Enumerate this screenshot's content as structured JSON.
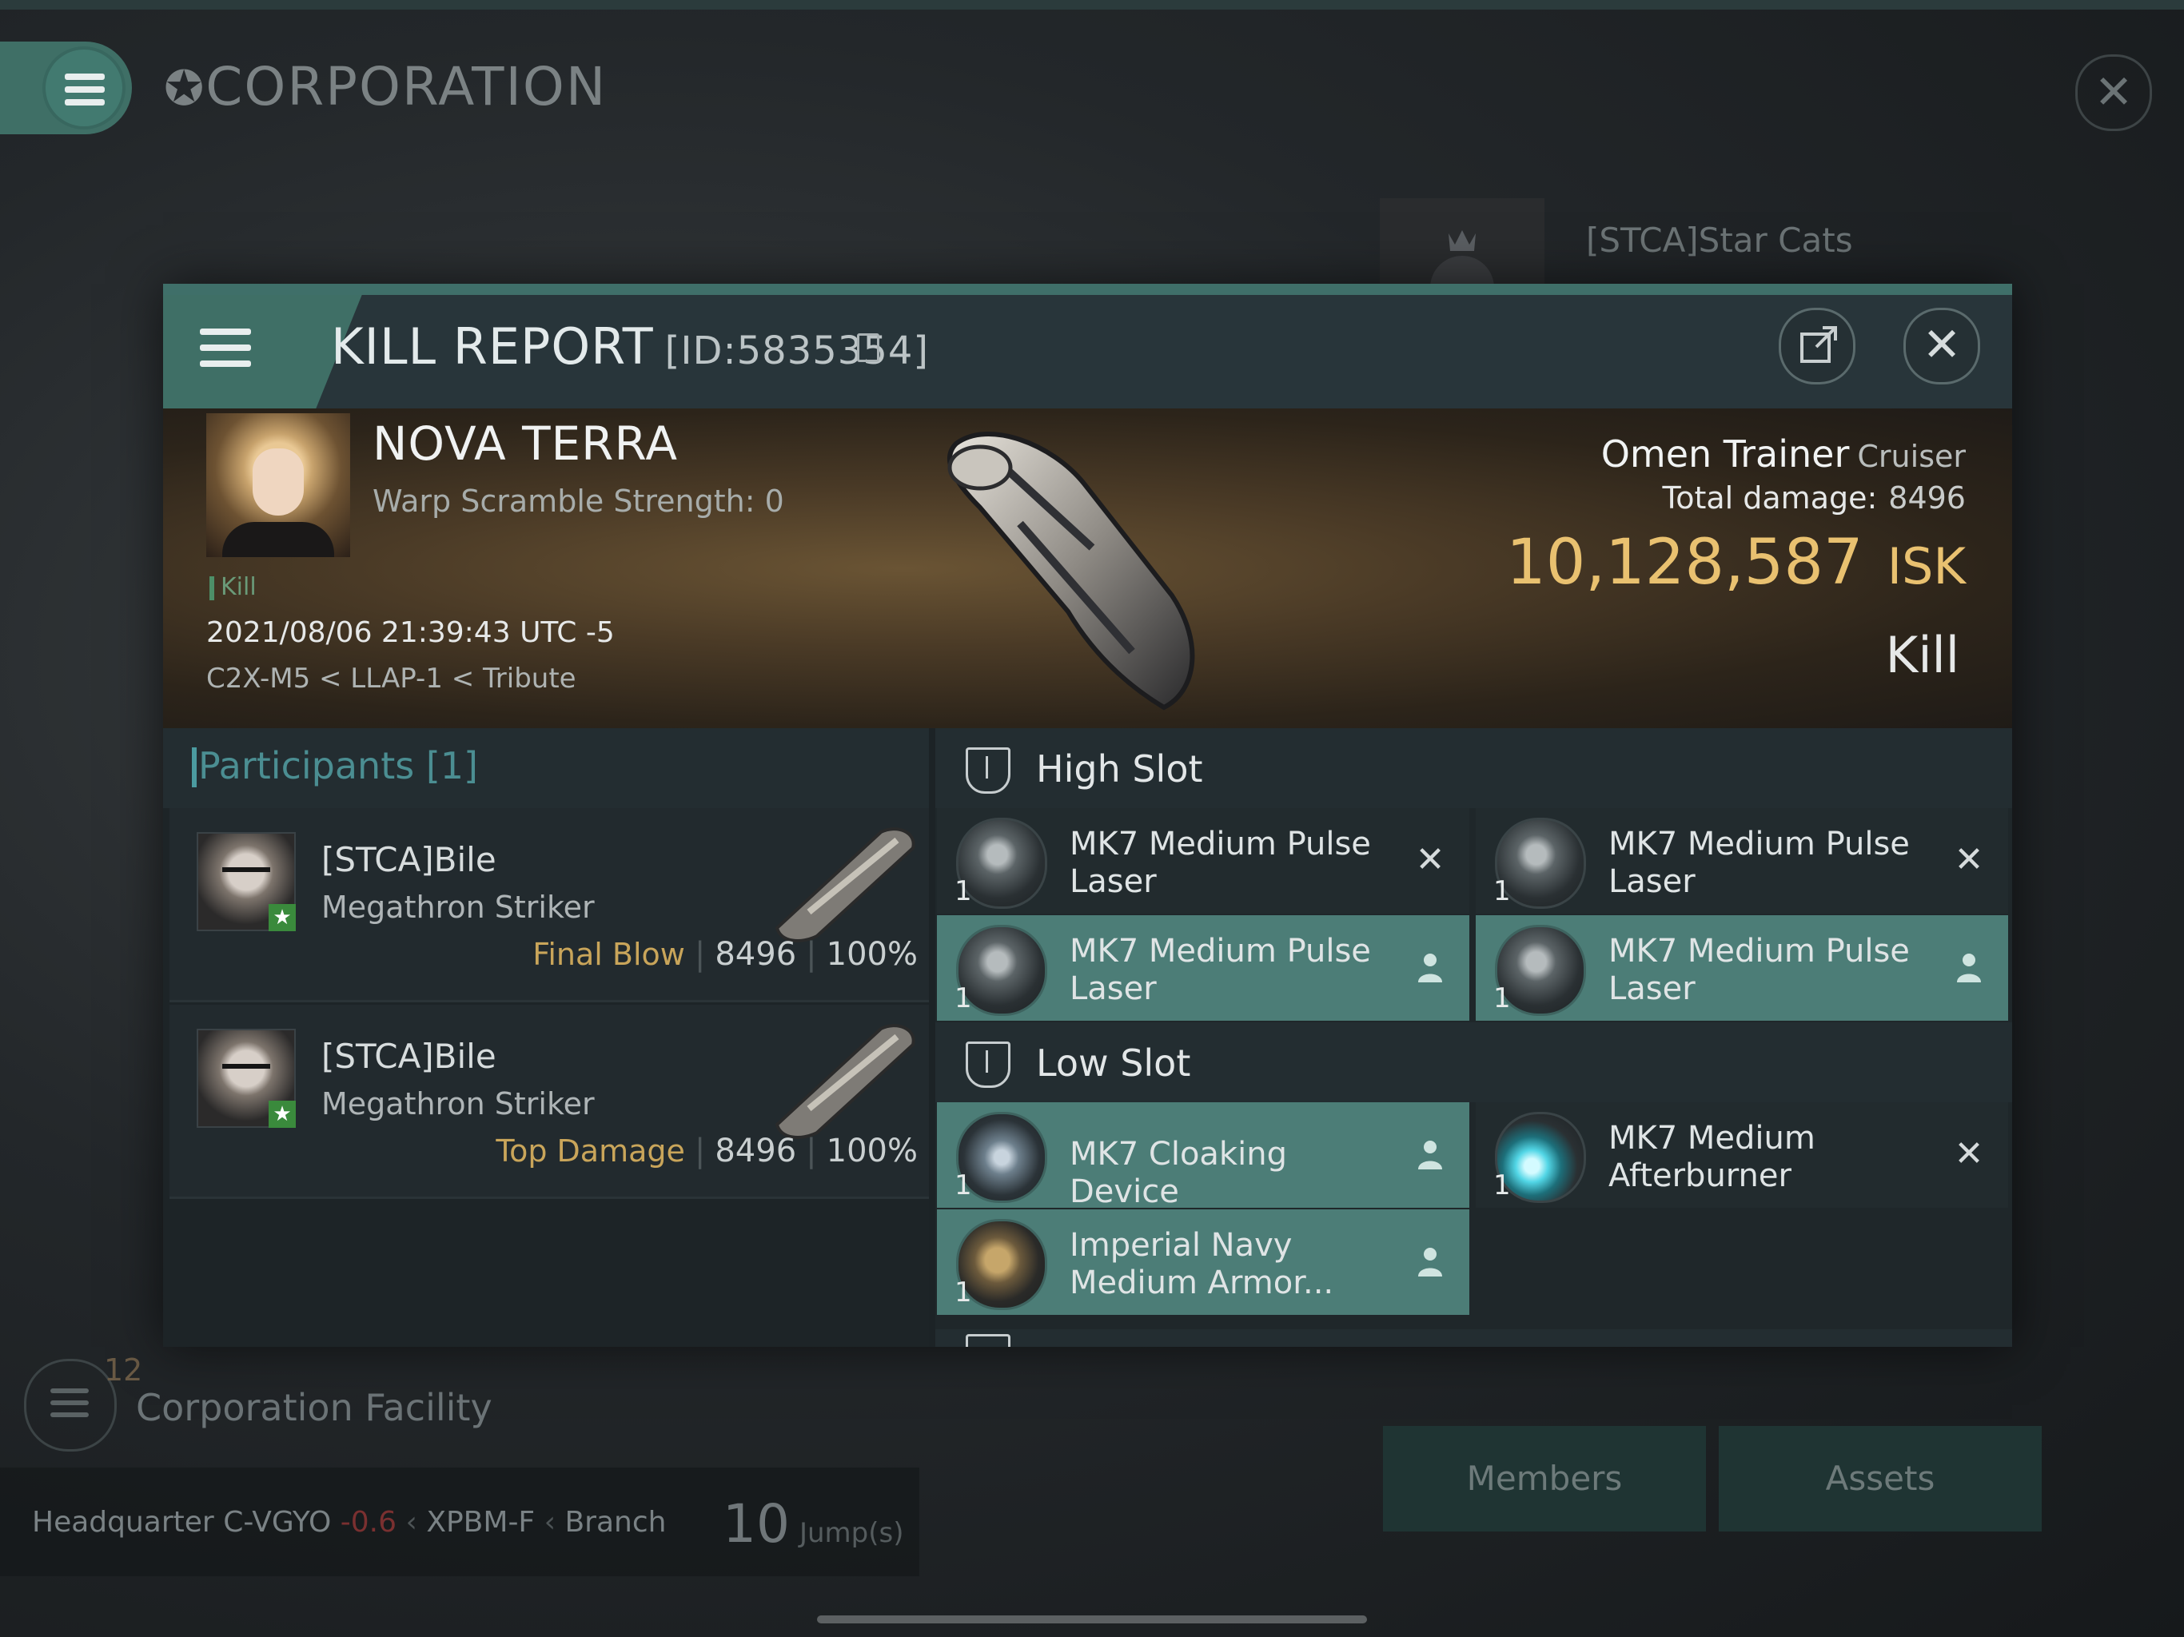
{
  "background": {
    "title": "CORPORATION",
    "corp_name": "[STCA]Star Cats",
    "facility_count": "12",
    "facility_label": "Corporation Facility",
    "hq_label": "Headquarter",
    "hq_system": "C-VGYO",
    "hq_security": "-0.6",
    "hq_region": "XPBM-F",
    "hq_type": "Branch",
    "jumps_value": "10",
    "jumps_unit": "Jump(s)",
    "buttons": [
      "Members",
      "Assets"
    ]
  },
  "kill_report": {
    "title": "KILL REPORT",
    "id": "[ID:5835354]",
    "victim": {
      "name": "NOVA TERRA",
      "warp_scramble": "Warp Scramble Strength: 0",
      "tag": "Kill",
      "datetime": "2021/08/06 21:39:43 UTC -5",
      "location": "C2X-M5 < LLAP-1 < Tribute"
    },
    "ship": {
      "name": "Omen Trainer",
      "class": "Cruiser",
      "total_damage_label": "Total damage:",
      "total_damage": "8496",
      "isk_value": "10,128,587",
      "isk_unit": "ISK",
      "result": "Kill"
    },
    "participants": {
      "header": "Participants [1]",
      "rows": [
        {
          "name": "[STCA]Bile",
          "ship": "Megathron Striker",
          "role": "Final Blow",
          "damage": "8496",
          "percent": "100%"
        },
        {
          "name": "[STCA]Bile",
          "ship": "Megathron Striker",
          "role": "Top Damage",
          "damage": "8496",
          "percent": "100%"
        }
      ]
    },
    "high_slot": {
      "title": "High Slot",
      "items": [
        {
          "qty": "1",
          "name": "MK7 Medium Pulse Laser",
          "status": "destroyed"
        },
        {
          "qty": "1",
          "name": "MK7 Medium Pulse Laser",
          "status": "destroyed"
        },
        {
          "qty": "1",
          "name": "MK7 Medium Pulse Laser",
          "status": "dropped"
        },
        {
          "qty": "1",
          "name": "MK7 Medium Pulse Laser",
          "status": "dropped"
        }
      ]
    },
    "low_slot": {
      "title": "Low Slot",
      "items": [
        {
          "qty": "1",
          "name": "MK7 Cloaking Device",
          "status": "dropped"
        },
        {
          "qty": "1",
          "name": "MK7 Medium Afterburner",
          "status": "destroyed"
        },
        {
          "qty": "1",
          "name": "Imperial Navy Medium Armor...",
          "status": "dropped"
        }
      ]
    },
    "icons": {
      "destroyed": "close-x-icon",
      "dropped": "person-icon"
    }
  }
}
